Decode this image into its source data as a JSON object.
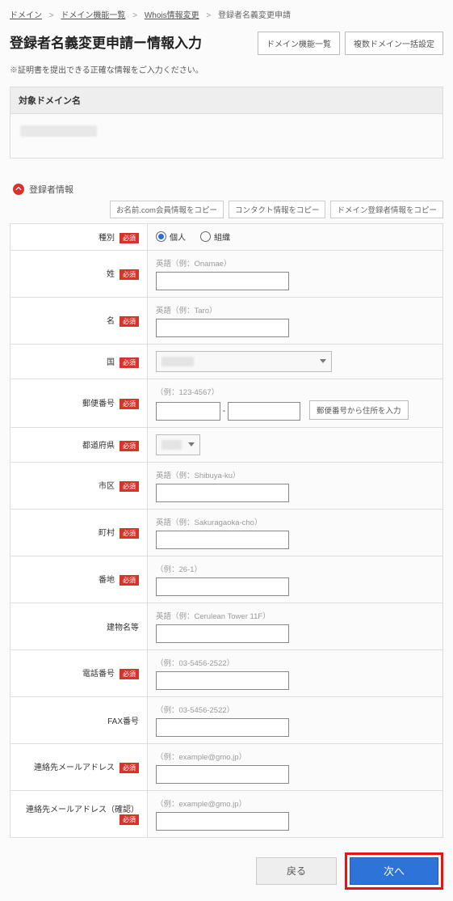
{
  "breadcrumb": {
    "items": [
      "ドメイン",
      "ドメイン機能一覧",
      "Whois情報変更",
      "登録者名義変更申請"
    ]
  },
  "header": {
    "title": "登録者名義変更申請ー情報入力",
    "btn_domain_list": "ドメイン機能一覧",
    "btn_bulk": "複数ドメイン一括設定"
  },
  "note": "※証明書を提出できる正確な情報をご入力ください。",
  "target_domain_label": "対象ドメイン名",
  "section": {
    "registrant_label": "登録者情報"
  },
  "copy_buttons": {
    "onamae": "お名前.com会員情報をコピー",
    "contact": "コンタクト情報をコピー",
    "domain": "ドメイン登録者情報をコピー"
  },
  "form": {
    "required_badge": "必須",
    "type": {
      "label": "種別",
      "opt1": "個人",
      "opt2": "組織"
    },
    "lastname": {
      "label": "姓",
      "hint": "英語（例：Onamae）"
    },
    "firstname": {
      "label": "名",
      "hint": "英語（例：Taro）"
    },
    "country": {
      "label": "国"
    },
    "postal": {
      "label": "郵便番号",
      "hint": "（例：123-4567）",
      "lookup_btn": "郵便番号から住所を入力"
    },
    "pref": {
      "label": "都道府県"
    },
    "city": {
      "label": "市区",
      "hint": "英語（例：Shibuya-ku）"
    },
    "town": {
      "label": "町村",
      "hint": "英語（例：Sakuragaoka-cho）"
    },
    "street": {
      "label": "番地",
      "hint": "（例：26-1）"
    },
    "building": {
      "label": "建物名等",
      "hint": "英語（例：Cerulean Tower 11F）"
    },
    "tel": {
      "label": "電話番号",
      "hint": "（例：03-5456-2522）"
    },
    "fax": {
      "label": "FAX番号",
      "hint": "（例：03-5456-2522）"
    },
    "email": {
      "label": "連絡先メールアドレス",
      "hint": "（例：example@gmo.jp）"
    },
    "email_confirm": {
      "label": "連絡先メールアドレス（確認）",
      "hint": "（例：example@gmo.jp）"
    }
  },
  "actions": {
    "back": "戻る",
    "next": "次へ"
  }
}
